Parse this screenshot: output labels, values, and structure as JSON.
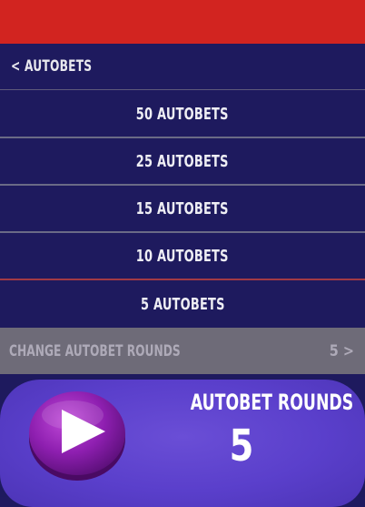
{
  "header": {
    "bar_color": "#d22420"
  },
  "menu": {
    "back_label": "< AUTOBETS",
    "options": [
      {
        "label": "50 AUTOBETS"
      },
      {
        "label": "25 AUTOBETS"
      },
      {
        "label": "15 AUTOBETS"
      },
      {
        "label": "10 AUTOBETS"
      },
      {
        "label": "5 AUTOBETS"
      }
    ],
    "change_label": "CHANGE AUTOBET ROUNDS",
    "change_value": "5 >"
  },
  "autobet": {
    "rounds_label": "AUTOBET ROUNDS",
    "rounds_value": "5",
    "play_icon": "play-icon"
  },
  "colors": {
    "background": "#1e1a5e",
    "panel": "#5a3fcb",
    "play_button": "#8a1aa8",
    "disabled_row": "#6e6b78"
  }
}
